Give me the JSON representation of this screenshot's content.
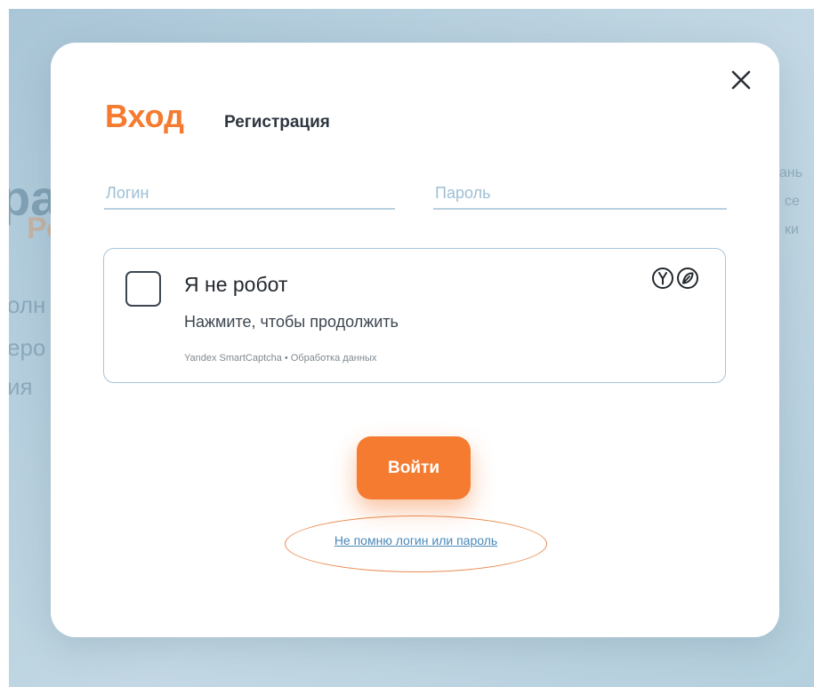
{
  "background": {
    "fragment_big": "pa",
    "fragment_orange": "Ро",
    "fragment_line1": "олн",
    "fragment_line2": "еро",
    "fragment_line3": "ия",
    "fragment_right1": "ань",
    "fragment_right2": "се",
    "fragment_right3": "ки"
  },
  "modal": {
    "close_icon": "close-icon",
    "tabs": {
      "login_label": "Вход",
      "register_label": "Регистрация"
    },
    "fields": {
      "login_placeholder": "Логин",
      "password_placeholder": "Пароль"
    },
    "captcha": {
      "title": "Я не робот",
      "subtitle": "Нажмите, чтобы продолжить",
      "footer_brand": "Yandex SmartCaptcha",
      "footer_separator": "•",
      "footer_link": "Обработка данных",
      "logo_icons": [
        "yandex-y-icon",
        "smartcaptcha-icon"
      ]
    },
    "submit_label": "Войти",
    "forgot_label": "Не помню логин или пароль"
  },
  "colors": {
    "accent": "#f47b30",
    "link": "#4a88b8",
    "field_underline": "#b8d0df",
    "backdrop": "#b4cfdd"
  }
}
